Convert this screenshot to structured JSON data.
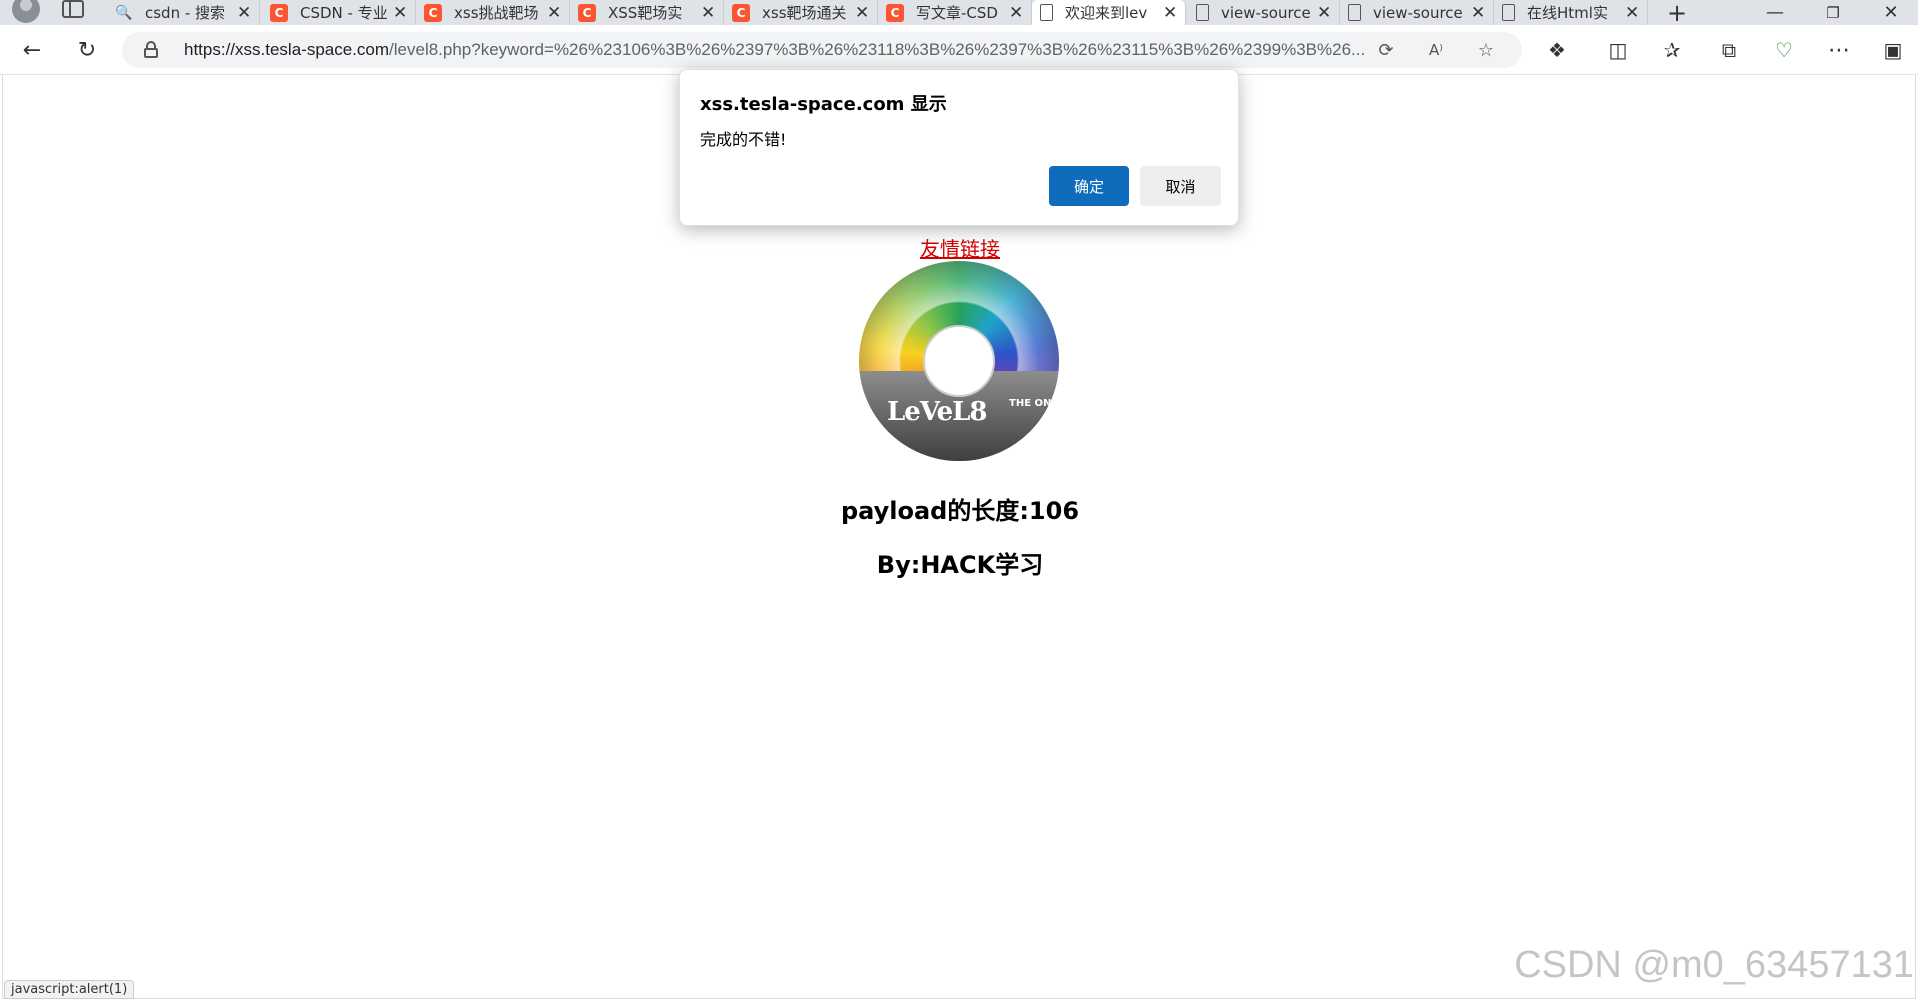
{
  "tabs": [
    {
      "title": "csdn - 搜索",
      "icon": "search-icon",
      "active": false
    },
    {
      "title": "CSDN - 专业",
      "icon": "csdn-icon",
      "active": false
    },
    {
      "title": "xss挑战靶场",
      "icon": "csdn-icon",
      "active": false
    },
    {
      "title": "XSS靶场实",
      "icon": "csdn-icon",
      "active": false
    },
    {
      "title": "xss靶场通关",
      "icon": "csdn-icon",
      "active": false
    },
    {
      "title": "写文章-CSD",
      "icon": "csdn-icon",
      "active": false
    },
    {
      "title": "欢迎来到lev",
      "icon": "page-icon",
      "active": true
    },
    {
      "title": "view-source",
      "icon": "page-icon",
      "active": false
    },
    {
      "title": "view-source",
      "icon": "page-icon",
      "active": false
    },
    {
      "title": "在线Html实",
      "icon": "page-icon",
      "active": false
    }
  ],
  "address": {
    "host": "https://xss.tesla-space.com",
    "path": "/level8.php?keyword=%26%23106%3B%26%2397%3B%26%23118%3B%26%2397%3B%26%23115%3B%26%2399%3B%26..."
  },
  "page": {
    "link_text": "友情链接",
    "disc_label": "LeVeL8",
    "disc_sub": "THE ONE",
    "payload_text": "payload的长度:106",
    "by_text": "By:HACK学习"
  },
  "dialog": {
    "title": "xss.tesla-space.com 显示",
    "message": "完成的不错!",
    "ok_label": "确定",
    "cancel_label": "取消"
  },
  "status_bar": "javascript:alert(1)",
  "watermark": "CSDN @m0_63457131",
  "colors": {
    "accent": "#0f6cbd",
    "link": "#d40000",
    "csdn": "#fc5531"
  }
}
